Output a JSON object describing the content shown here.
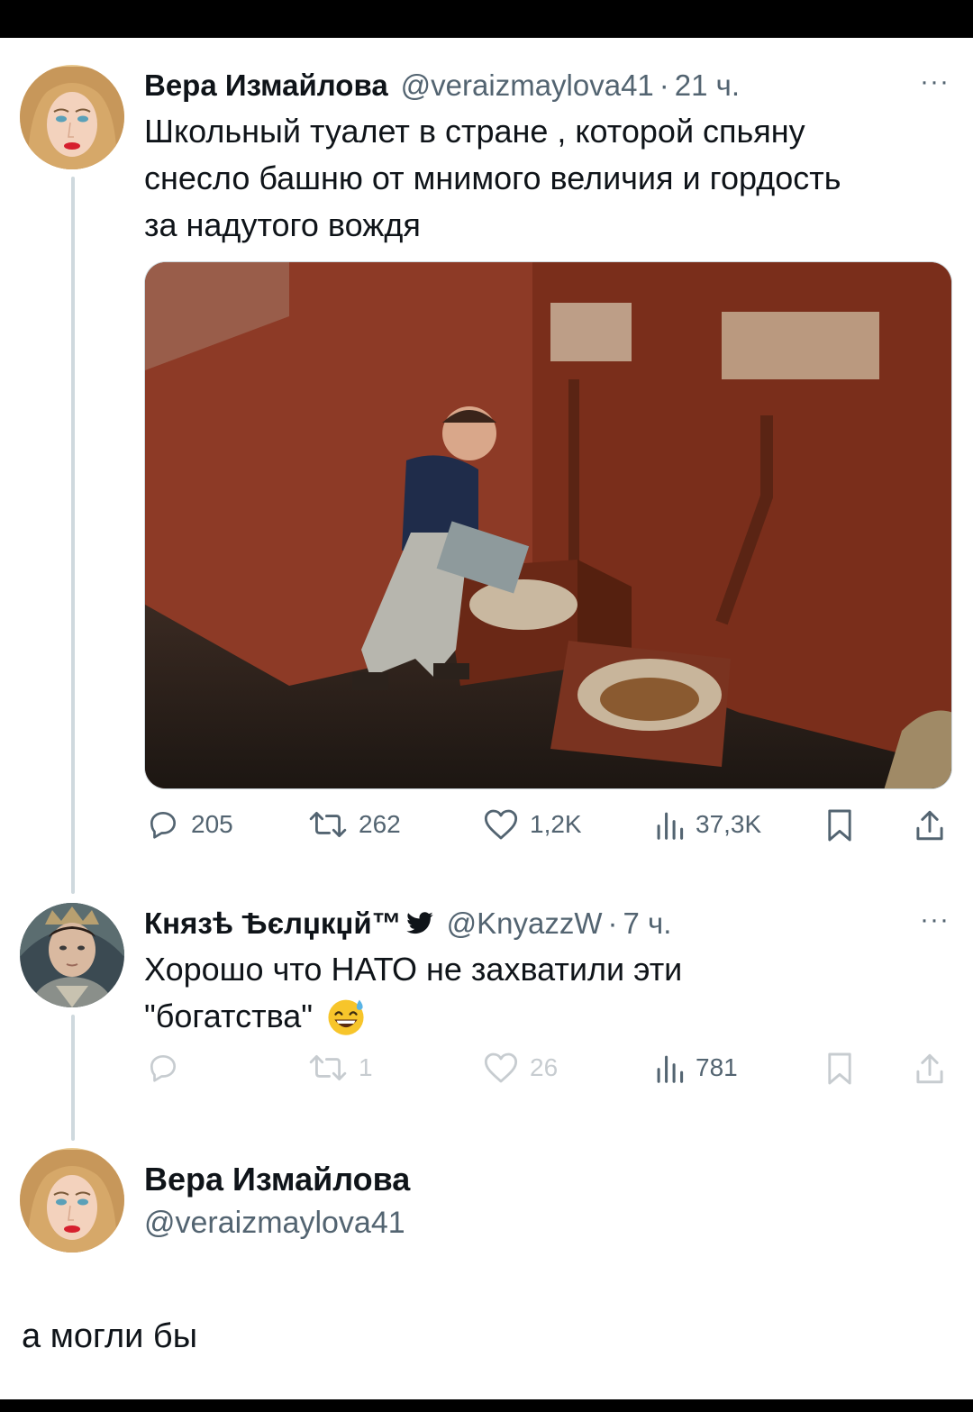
{
  "tweet1": {
    "name": "Вера Измайлова",
    "handle": "@veraizmaylova41",
    "dot": "·",
    "time": "21 ч.",
    "more": "···",
    "text_lines": [
      "Школьный туалет в стране , которой спьяну",
      "снесло башню от мнимого величия и гордость",
      "за надутого вождя"
    ],
    "stats": {
      "replies": "205",
      "reposts": "262",
      "likes": "1,2K",
      "views": "37,3K"
    }
  },
  "tweet2": {
    "name": "Князѣ Ѣєлџкџй™",
    "handle": "@KnyazzW",
    "dot": "·",
    "time": "7 ч.",
    "more": "···",
    "text_lines": [
      "Хорошо что НАТО не захватили эти",
      "\"богатства\""
    ],
    "stats": {
      "replies": "",
      "reposts": "1",
      "likes": "26",
      "views": "781"
    }
  },
  "tweet3": {
    "name": "Вера Измайлова",
    "handle": "@veraizmaylova41",
    "text": "а могли бы"
  },
  "icons": {
    "reply": "reply-icon",
    "repost": "repost-icon",
    "like": "heart-icon",
    "views": "views-icon",
    "bookmark": "bookmark-icon",
    "share": "share-icon",
    "verified": "bird-icon",
    "emoji": "sweat-smile-emoji"
  },
  "colors": {
    "text": "#0f1419",
    "secondary": "#536471",
    "line": "#cfd9de",
    "emoji": "#f7c52b"
  }
}
